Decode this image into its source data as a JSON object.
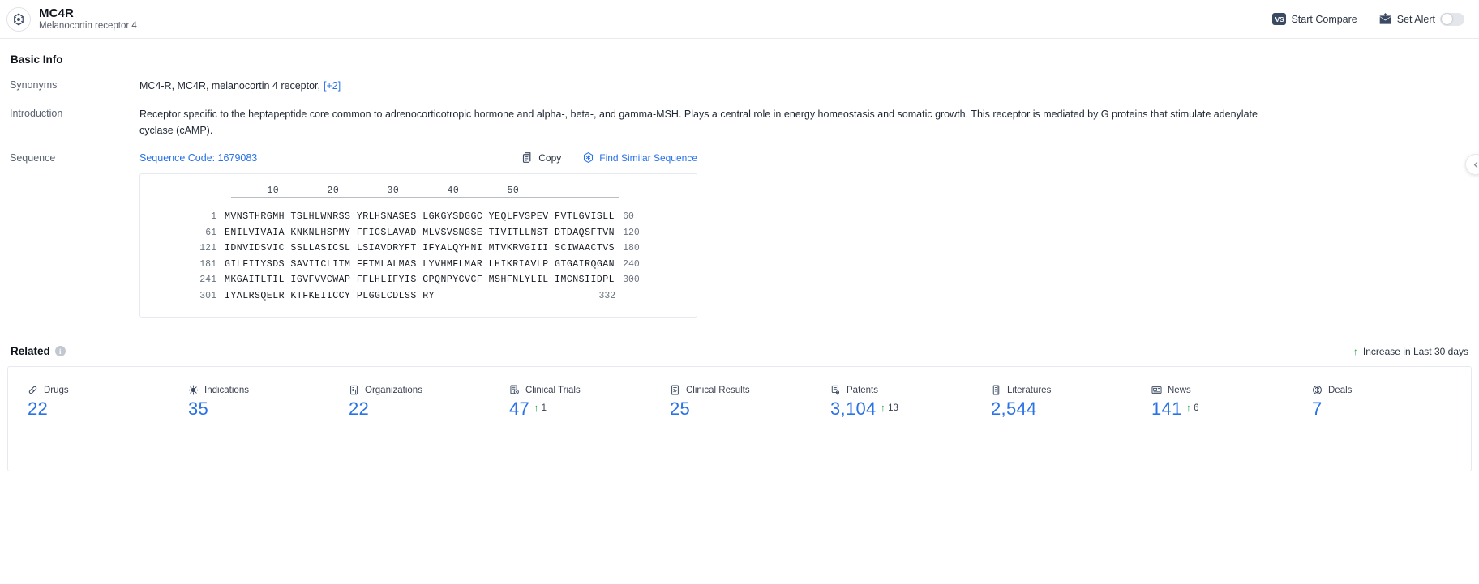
{
  "header": {
    "icon": "target-crosshair-icon",
    "title": "MC4R",
    "subtitle": "Melanocortin receptor 4",
    "compare_badge": "VS",
    "compare_label": "Start Compare",
    "alert_icon": "alert-envelope-icon",
    "alert_label": "Set Alert",
    "alert_toggle_state": "off"
  },
  "basic_info": {
    "section_title": "Basic Info",
    "synonyms_label": "Synonyms",
    "synonyms_value": "MC4-R,  MC4R,  melanocortin 4 receptor,",
    "synonyms_more": "[+2]",
    "introduction_label": "Introduction",
    "introduction_value": "Receptor specific to the heptapeptide core common to adrenocorticotropic hormone and alpha-, beta-, and gamma-MSH. Plays a central role in energy homeostasis and somatic growth. This receptor is mediated by G proteins that stimulate adenylate cyclase (cAMP).",
    "sequence_label": "Sequence",
    "sequence_code": "Sequence Code: 1679083",
    "copy_label": "Copy",
    "copy_icon": "copy-icon",
    "find_similar_label": "Find Similar Sequence",
    "find_similar_icon": "find-similar-icon"
  },
  "sequence": {
    "ruler": "      10        20        30        40        50",
    "rows": [
      {
        "start": "1",
        "residues": "MVNSTHRGMH TSLHLWNRSS YRLHSNASES LGKGYSDGGC YEQLFVSPEV FVTLGVISLL",
        "end": "60"
      },
      {
        "start": "61",
        "residues": "ENILVIVAIA KNKNLHSPMY FFICSLAVAD MLVSVSNGSE TIVITLLNST DTDAQSFTVN",
        "end": "120"
      },
      {
        "start": "121",
        "residues": "IDNVIDSVIC SSLLASICSL LSIAVDRYFT IFYALQYHNI MTVKRVGIII SCIWAACTVS",
        "end": "180"
      },
      {
        "start": "181",
        "residues": "GILFIIYSDS SAVIICLITM FFTMLALMAS LYVHMFLMAR LHIKRIAVLP GTGAIRQGAN",
        "end": "240"
      },
      {
        "start": "241",
        "residues": "MKGAITLTIL IGVFVVCWAP FFLHLIFYIS CPQNPYCVCF MSHFNLYLIL IMCNSIIDPL",
        "end": "300"
      },
      {
        "start": "301",
        "residues": "IYALRSQELR KTFKEIICCY PLGGLCDLSS RY",
        "end": "332"
      }
    ]
  },
  "related": {
    "title": "Related",
    "info_glyph": "i",
    "increase_note": "Increase in Last 30 days",
    "increase_arrow": "↑",
    "stats": [
      {
        "icon": "pill-icon",
        "label": "Drugs",
        "value": "22",
        "delta": ""
      },
      {
        "icon": "virus-icon",
        "label": "Indications",
        "value": "35",
        "delta": ""
      },
      {
        "icon": "organization-icon",
        "label": "Organizations",
        "value": "22",
        "delta": ""
      },
      {
        "icon": "clinical-trial-icon",
        "label": "Clinical Trials",
        "value": "47",
        "delta": "1"
      },
      {
        "icon": "clinical-result-icon",
        "label": "Clinical Results",
        "value": "25",
        "delta": ""
      },
      {
        "icon": "patent-icon",
        "label": "Patents",
        "value": "3,104",
        "delta": "13"
      },
      {
        "icon": "literature-icon",
        "label": "Literatures",
        "value": "2,544",
        "delta": ""
      },
      {
        "icon": "news-icon",
        "label": "News",
        "value": "141",
        "delta": "6"
      },
      {
        "icon": "deal-icon",
        "label": "Deals",
        "value": "7",
        "delta": ""
      }
    ]
  },
  "colors": {
    "accent_blue": "#2a72e8",
    "increase_green": "#24a148",
    "dark_navy": "#3b4a63"
  }
}
